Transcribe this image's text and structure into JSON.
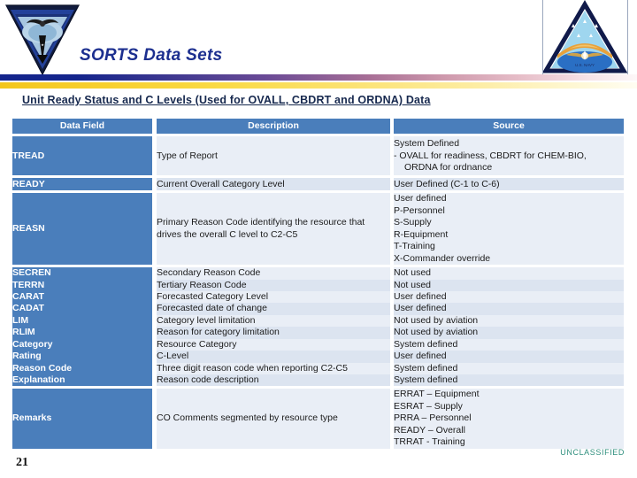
{
  "slide": {
    "title": "SORTS Data Sets",
    "section_heading": "Unit Ready Status and C Levels (Used for OVALL, CBDRT and ORDNA) Data",
    "page_number": "21",
    "classification": "UNCLASSIFIED",
    "left_logo_name": "navy-unit-triangle-patch",
    "right_logo_name": "aviation-triangle-patch"
  },
  "colors": {
    "title_blue": "#1c2f8f",
    "table_header_blue": "#4a7ebb",
    "field_blue": "#4a7ebb",
    "row_light": "#e9eef6",
    "row_dark": "#dce4f0",
    "classification_green": "#2f8f7e",
    "bar_start_blue": "#14258c",
    "bar_gold": "#f3c61c"
  },
  "table": {
    "columns": [
      "Data Field",
      "Description",
      "Source"
    ],
    "rows": [
      {
        "field": "TREAD",
        "description": "Type of Report",
        "source_lines": [
          "System Defined",
          "-   OVALL for readiness, CBDRT for CHEM-BIO,",
          "ORDNA for ordnance"
        ],
        "source_text": "System Defined\n-  OVALL for readiness, CBDRT for CHEM-BIO, ORDNA for ordnance",
        "height": "tall"
      },
      {
        "field": "READY",
        "description": "Current Overall Category Level",
        "source_text": "User Defined (C-1 to C-6)",
        "height": "single"
      },
      {
        "field": "REASN",
        "description": "Primary Reason Code identifying the resource that drives the overall C level to C2-C5",
        "source_lines": [
          "User defined",
          "P-Personnel",
          "S-Supply",
          "R-Equipment",
          "T-Training",
          "X-Commander override"
        ],
        "height": "tall"
      },
      {
        "field": "SECREN",
        "description": "Secondary Reason Code",
        "source_text": "Not used",
        "height": "compact"
      },
      {
        "field": "TERRN",
        "description": "Tertiary Reason Code",
        "source_text": "Not used",
        "height": "compact"
      },
      {
        "field": "CARAT",
        "description": "Forecasted Category  Level",
        "source_text": "User defined",
        "height": "compact"
      },
      {
        "field": "CADAT",
        "description": "Forecasted date of change",
        "source_text": "User defined",
        "height": "compact"
      },
      {
        "field": "LIM",
        "description": "Category level limitation",
        "source_text": "Not used by aviation",
        "height": "compact"
      },
      {
        "field": "RLIM",
        "description": "Reason for category limitation",
        "source_text": "Not used by aviation",
        "height": "compact"
      },
      {
        "field": "Category",
        "description": "Resource Category",
        "source_text": "System defined",
        "height": "compact"
      },
      {
        "field": "Rating",
        "description": "C-Level",
        "source_text": "User defined",
        "height": "compact"
      },
      {
        "field": "Reason Code",
        "description": "Three digit reason code when reporting C2-C5",
        "source_text": "System defined",
        "height": "compact"
      },
      {
        "field": "Explanation",
        "description": "Reason code description",
        "source_text": "System defined",
        "height": "compact"
      },
      {
        "field": "Remarks",
        "description": "CO Comments segmented by resource type",
        "source_lines": [
          "ERRAT – Equipment",
          "ESRAT – Supply",
          "PRRA – Personnel",
          "READY – Overall",
          "TRRAT - Training"
        ],
        "height": "tall"
      }
    ]
  }
}
